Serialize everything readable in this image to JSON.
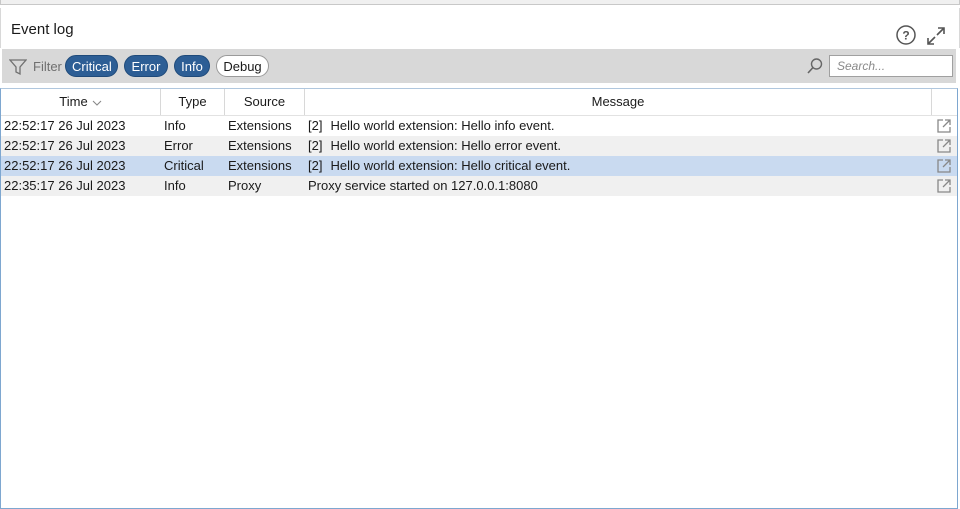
{
  "header": {
    "title": "Event log",
    "help_icon": "question-circle-icon",
    "expand_icon": "expand-arrows-icon"
  },
  "filter": {
    "icon": "funnel-icon",
    "label": "Filter",
    "pills": [
      {
        "label": "Critical",
        "active": true
      },
      {
        "label": "Error",
        "active": true
      },
      {
        "label": "Info",
        "active": true
      },
      {
        "label": "Debug",
        "active": false
      }
    ],
    "search": {
      "icon": "search-icon",
      "placeholder": "Search...",
      "value": ""
    }
  },
  "table": {
    "columns": {
      "time": "Time",
      "type": "Type",
      "source": "Source",
      "message": "Message"
    },
    "sort_icon": "chevron-down-icon",
    "rows": [
      {
        "time": "22:52:17 26 Jul 2023",
        "type": "Info",
        "source": "Extensions",
        "count": "[2]",
        "message": "Hello world extension: Hello info event.",
        "selected": false
      },
      {
        "time": "22:52:17 26 Jul 2023",
        "type": "Error",
        "source": "Extensions",
        "count": "[2]",
        "message": "Hello world extension: Hello error event.",
        "selected": false
      },
      {
        "time": "22:52:17 26 Jul 2023",
        "type": "Critical",
        "source": "Extensions",
        "count": "[2]",
        "message": "Hello world extension: Hello critical event.",
        "selected": true
      },
      {
        "time": "22:35:17 26 Jul 2023",
        "type": "Info",
        "source": "Proxy",
        "count": "",
        "message": "Proxy service started on 127.0.0.1:8080",
        "selected": false
      }
    ],
    "row_action_icon": "open-external-icon"
  },
  "colors": {
    "pill_active": "#2d5e95",
    "selected_row": "#c9daf0",
    "alt_row": "#f0f0f0",
    "filterbar": "#d8d8d8"
  }
}
